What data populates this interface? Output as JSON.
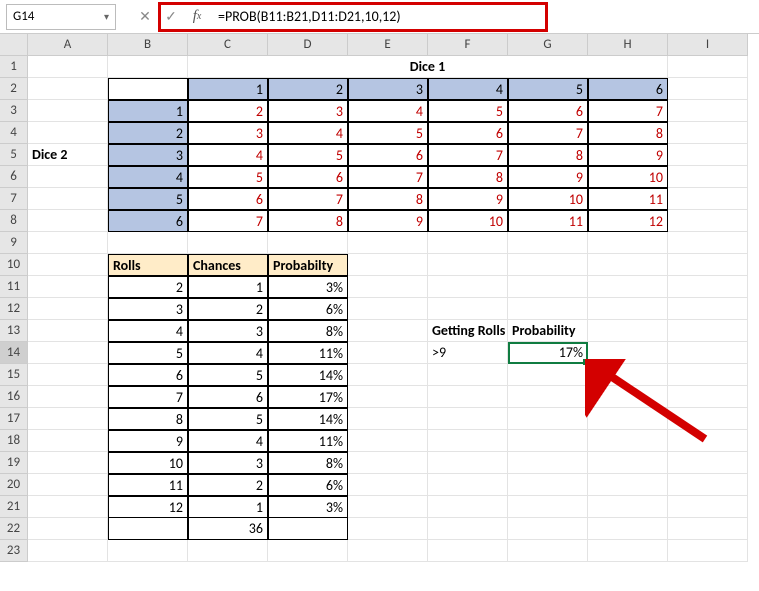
{
  "nameBox": "G14",
  "formula": "=PROB(B11:B21,D11:D21,10,12)",
  "colHeaders": [
    "A",
    "B",
    "C",
    "D",
    "E",
    "F",
    "G",
    "H",
    "I"
  ],
  "rowHeaders": [
    1,
    2,
    3,
    4,
    5,
    6,
    7,
    8,
    9,
    10,
    11,
    12,
    13,
    14,
    15,
    16,
    17,
    18,
    19,
    20,
    21,
    22,
    23
  ],
  "dice1Title": "Dice 1",
  "dice2Title": "Dice 2",
  "diceCols": [
    1,
    2,
    3,
    4,
    5,
    6
  ],
  "diceRows": [
    1,
    2,
    3,
    4,
    5,
    6
  ],
  "diceSums": [
    [
      2,
      3,
      4,
      5,
      6,
      7
    ],
    [
      3,
      4,
      5,
      6,
      7,
      8
    ],
    [
      4,
      5,
      6,
      7,
      8,
      9
    ],
    [
      5,
      6,
      7,
      8,
      9,
      10
    ],
    [
      6,
      7,
      8,
      9,
      10,
      11
    ],
    [
      7,
      8,
      9,
      10,
      11,
      12
    ]
  ],
  "tblHeaders": {
    "rolls": "Rolls",
    "chances": "Chances",
    "prob": "Probabilty"
  },
  "tbl": [
    {
      "r": 2,
      "c": 1,
      "p": "3%"
    },
    {
      "r": 3,
      "c": 2,
      "p": "6%"
    },
    {
      "r": 4,
      "c": 3,
      "p": "8%"
    },
    {
      "r": 5,
      "c": 4,
      "p": "11%"
    },
    {
      "r": 6,
      "c": 5,
      "p": "14%"
    },
    {
      "r": 7,
      "c": 6,
      "p": "17%"
    },
    {
      "r": 8,
      "c": 5,
      "p": "14%"
    },
    {
      "r": 9,
      "c": 4,
      "p": "11%"
    },
    {
      "r": 10,
      "c": 3,
      "p": "8%"
    },
    {
      "r": 11,
      "c": 2,
      "p": "6%"
    },
    {
      "r": 12,
      "c": 1,
      "p": "3%"
    }
  ],
  "chancesTotal": "36",
  "side": {
    "gettingRolls": "Getting Rolls",
    "probability": "Probability",
    "cond": ">9",
    "result": "17%"
  }
}
